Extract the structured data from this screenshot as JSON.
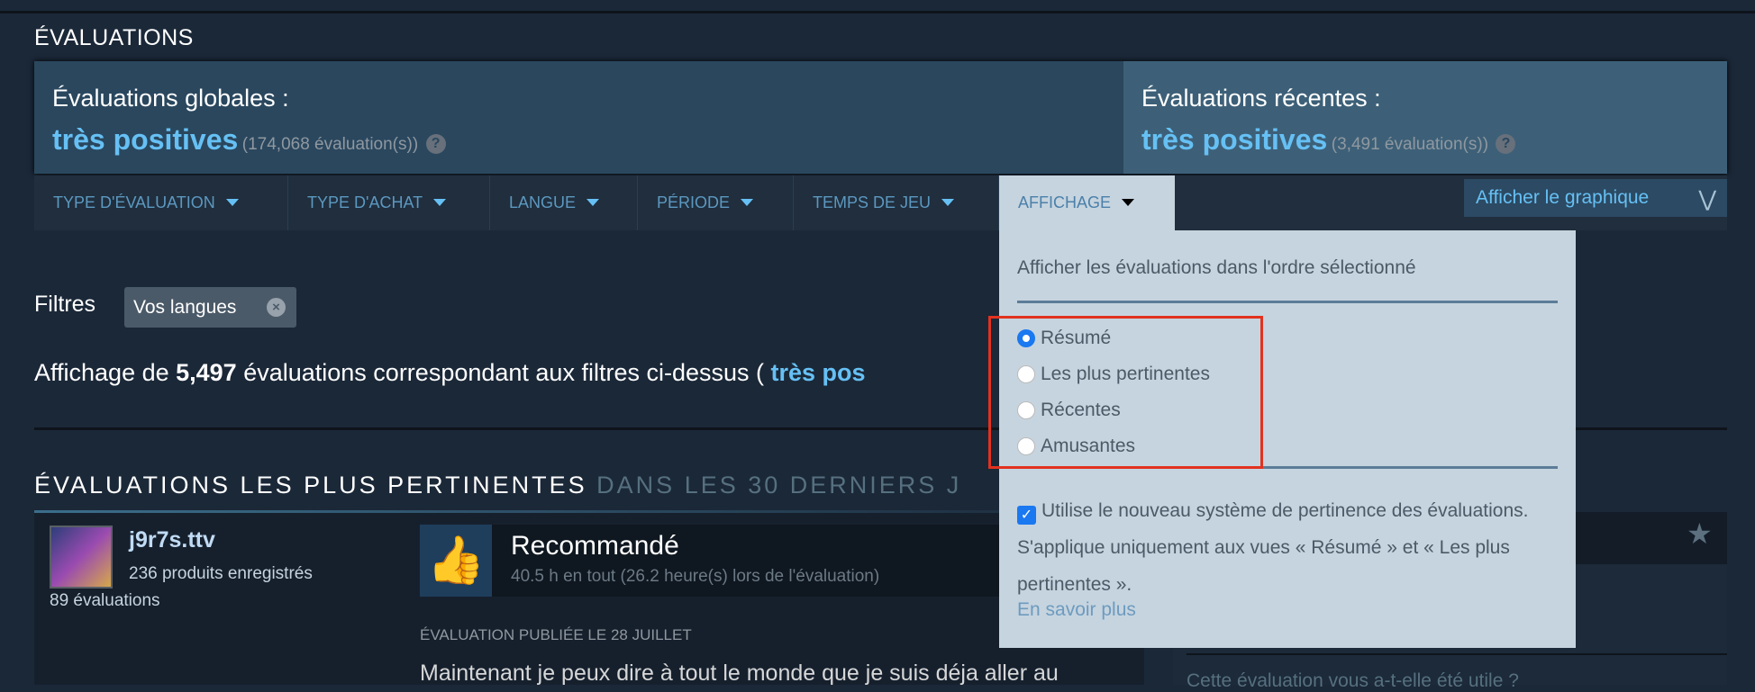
{
  "title": "ÉVALUATIONS",
  "summary": {
    "overall": {
      "label": "Évaluations globales :",
      "rating": "très positives",
      "count": "(174,068 évaluation(s))"
    },
    "recent": {
      "label": "Évaluations récentes :",
      "rating": "très positives",
      "count": "(3,491 évaluation(s))"
    },
    "help_glyph": "?"
  },
  "filters": {
    "tabs": [
      {
        "label": "TYPE D'ÉVALUATION"
      },
      {
        "label": "TYPE D'ACHAT"
      },
      {
        "label": "LANGUE"
      },
      {
        "label": "PÉRIODE"
      },
      {
        "label": "TEMPS DE JEU"
      },
      {
        "label": "AFFICHAGE"
      }
    ],
    "graph_button": "Afficher le graphique",
    "label": "Filtres",
    "chip": "Vos langues"
  },
  "dropdown": {
    "heading": "Afficher les évaluations dans l'ordre sélectionné",
    "options": [
      {
        "label": "Résumé",
        "selected": true
      },
      {
        "label": "Les plus pertinentes",
        "selected": false
      },
      {
        "label": "Récentes",
        "selected": false
      },
      {
        "label": "Amusantes",
        "selected": false
      }
    ],
    "checkbox_label": "Utilise le nouveau système de pertinence des évaluations. S'applique uniquement aux vues « Résumé » et « Les plus pertinentes ».",
    "checkbox_checked": true,
    "learn_more": "En savoir plus"
  },
  "showing": {
    "prefix": "Affichage de ",
    "count": "5,497",
    "middle": " évaluations correspondant aux filtres ci-dessus ( ",
    "rating": "très pos"
  },
  "section": {
    "title": "ÉVALUATIONS LES PLUS PERTINENTES",
    "subtitle": "DANS LES 30 DERNIERS J"
  },
  "review": {
    "username": "j9r7s.ttv",
    "products": "236 produits enregistrés",
    "reviews": "89 évaluations",
    "verdict": "Recommandé",
    "hours": "40.5 h en tout (26.2 heure(s) lors de l'évaluation)",
    "posted": "ÉVALUATION PUBLIÉE LE 28 JUILLET",
    "body": "Maintenant je peux dire à tout le monde que je suis déja aller au",
    "helpful": "Cette évaluation vous a-t-elle été utile ?"
  },
  "colors": {
    "accent": "#66c0f4",
    "background": "#1b2838",
    "highlight": "#e2321f"
  }
}
